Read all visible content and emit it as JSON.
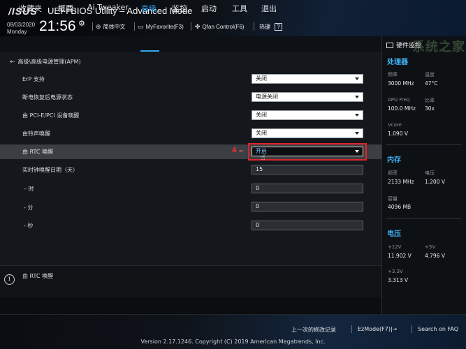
{
  "header": {
    "logo": "/ISUS",
    "title": "UEFI BIOS Utility – Advanced Mode",
    "date": "08/03/2020",
    "weekday": "Monday",
    "time": "21:56",
    "language": "简体中文",
    "myfavorite": "MyFavorite(F3)",
    "qfan": "Qfan Control(F6)",
    "hotkeys": "热键",
    "help_glyph": "?"
  },
  "nav": {
    "tabs": [
      "收藏夹",
      "概要",
      "Ai Tweaker",
      "高级",
      "监控",
      "启动",
      "工具",
      "退出"
    ],
    "active_tab": "高级"
  },
  "breadcrumb": "高级\\高级电源管理(APM)",
  "settings": [
    {
      "label": "ErP 支持",
      "value": "关闭"
    },
    {
      "label": "断电恢复后电源状态",
      "value": "电源关闭"
    },
    {
      "label": "由 PCI-E/PCI 设备唤醒",
      "value": "关闭"
    },
    {
      "label": "由铃声唤醒",
      "value": "关闭"
    },
    {
      "label": "由 RTC 唤醒",
      "value": "开启"
    }
  ],
  "rtc_fields": [
    {
      "label": "实时钟唤醒日期（天）",
      "value": "15"
    },
    {
      "label": "– 时",
      "value": "0"
    },
    {
      "label": "- 分",
      "value": "0"
    },
    {
      "label": "- 秒",
      "value": "0"
    }
  ],
  "annotation": {
    "number": "4",
    "arrow": "⇐"
  },
  "help": {
    "text": "由 RTC 唤醒",
    "icon_glyph": "i"
  },
  "monitor": {
    "title": "硬件监控",
    "watermark": "系统之家",
    "cpu": {
      "section": "处理器",
      "freq_label": "频率",
      "freq_value": "3000 MHz",
      "temp_label": "温度",
      "temp_value": "47°C",
      "apu_label": "APU Freq",
      "apu_value": "100.0 MHz",
      "ratio_label": "比率",
      "ratio_value": "30x",
      "vcore_label": "Vcore",
      "vcore_value": "1.090 V"
    },
    "memory": {
      "section": "内存",
      "freq_label": "频率",
      "freq_value": "2133 MHz",
      "volt_label": "电压",
      "volt_value": "1.200 V",
      "cap_label": "容量",
      "cap_value": "4096 MB"
    },
    "voltage": {
      "section": "电压",
      "v12_label": "+12V",
      "v12_value": "11.902 V",
      "v5_label": "+5V",
      "v5_value": "4.796 V",
      "v33_label": "+3.3V",
      "v33_value": "3.313 V"
    }
  },
  "footer": {
    "last_modified": "上一次的修改记录",
    "ezmode": "EzMode(F7)|→",
    "search": "Search on FAQ",
    "version": "Version 2.17.1246. Copyright (C) 2019 American Megatrends, Inc."
  },
  "colors": {
    "accent": "#32a8f0",
    "highlight_row": "#3b3e43",
    "annotation_red": "#e0232a"
  }
}
